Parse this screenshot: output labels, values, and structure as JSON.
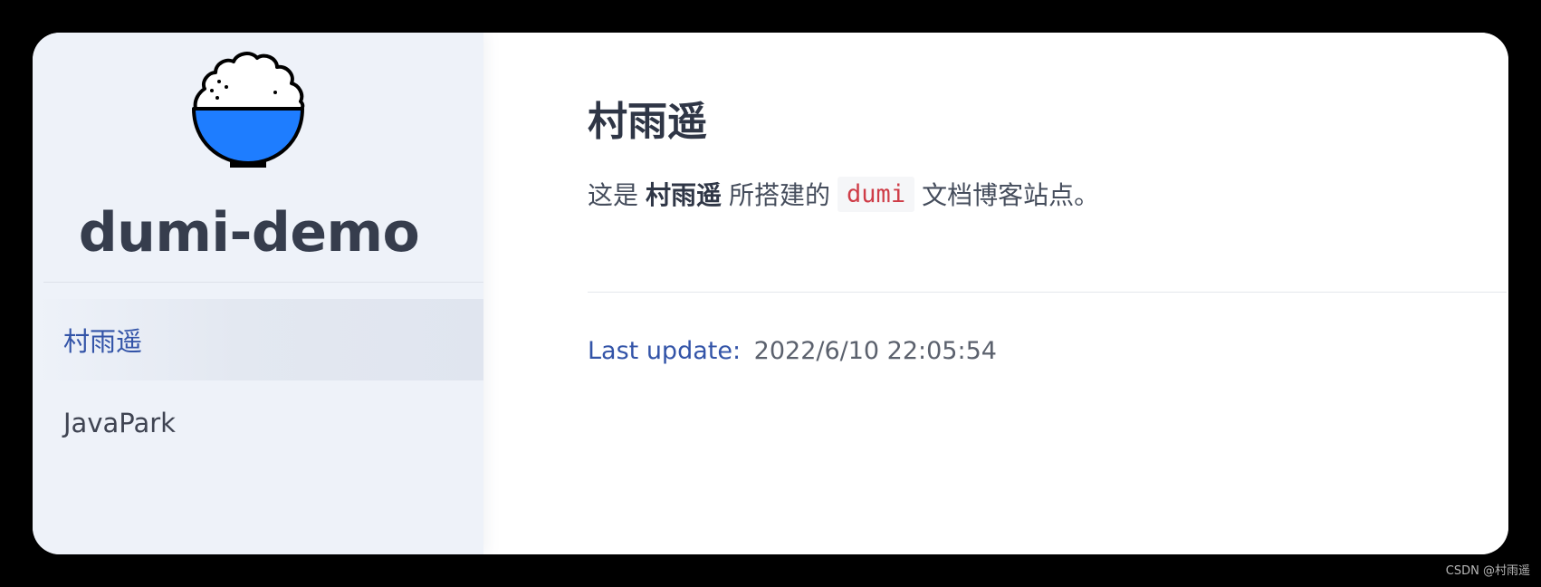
{
  "site": {
    "title": "dumi-demo",
    "logo_icon": "rice-bowl-icon"
  },
  "sidebar": {
    "items": [
      {
        "label": "村雨遥",
        "active": true
      },
      {
        "label": "JavaPark",
        "active": false
      }
    ]
  },
  "main": {
    "title": "村雨遥",
    "intro": {
      "before": "这是",
      "strong": "村雨遥",
      "middle": "所搭建的",
      "code": "dumi",
      "after": "文档博客站点。"
    },
    "last_update": {
      "label": "Last update:",
      "value": "2022/6/10 22:05:54"
    }
  },
  "watermark": "CSDN @村雨遥",
  "colors": {
    "accent": "#3354a8",
    "logo_blue": "#1e7dff",
    "code_red": "#cf3d48",
    "sidebar_bg": "#eef2f9",
    "title_text": "#363d4d"
  }
}
